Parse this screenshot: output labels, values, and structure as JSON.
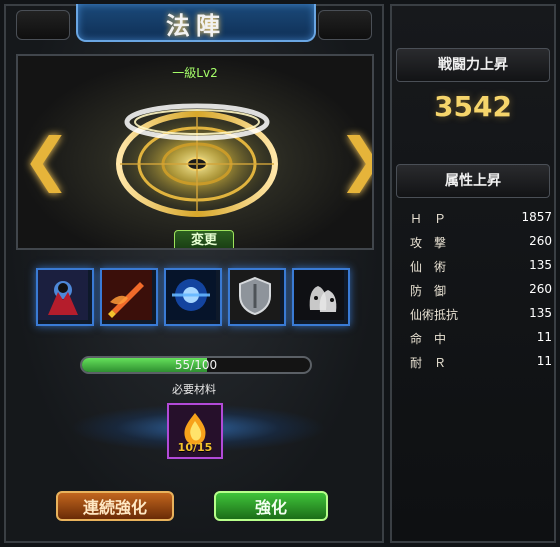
{
  "title": "法陣",
  "formation": {
    "level_text": "一級Lv2",
    "change_button": "変更",
    "nav_left_icon": "left-chevron-icon",
    "nav_right_icon": "right-chevron-icon"
  },
  "skills": [
    {
      "icon": "dark-spirit-icon"
    },
    {
      "icon": "flame-sword-icon"
    },
    {
      "icon": "blue-orb-icon"
    },
    {
      "icon": "shield-icon"
    },
    {
      "icon": "ghost-duo-icon"
    }
  ],
  "progress": {
    "text": "55/100",
    "current": 55,
    "max": 100
  },
  "materials": {
    "label": "必要材料",
    "count_text": "10/15",
    "icon": "fire-emblem-icon"
  },
  "buttons": {
    "continuous": "連続強化",
    "enhance": "強化"
  },
  "right_panel": {
    "power_header": "戦闘力上昇",
    "power_value": "3542",
    "attr_header": "属性上昇",
    "attributes": [
      {
        "name": "Ｈ　Ｐ",
        "value": "1857"
      },
      {
        "name": "攻　撃",
        "value": "260"
      },
      {
        "name": "仙　術",
        "value": "135"
      },
      {
        "name": "防　御",
        "value": "260"
      },
      {
        "name": "仙術抵抗",
        "value": "135"
      },
      {
        "name": "命　中",
        "value": "11"
      },
      {
        "name": "耐　Ｒ",
        "value": "11"
      }
    ]
  },
  "colors": {
    "accent_gold": "#f6d56b",
    "progress_green": "#64e05a",
    "skill_border_blue": "#3a7bd5",
    "material_border_purple": "#b24ad8"
  }
}
